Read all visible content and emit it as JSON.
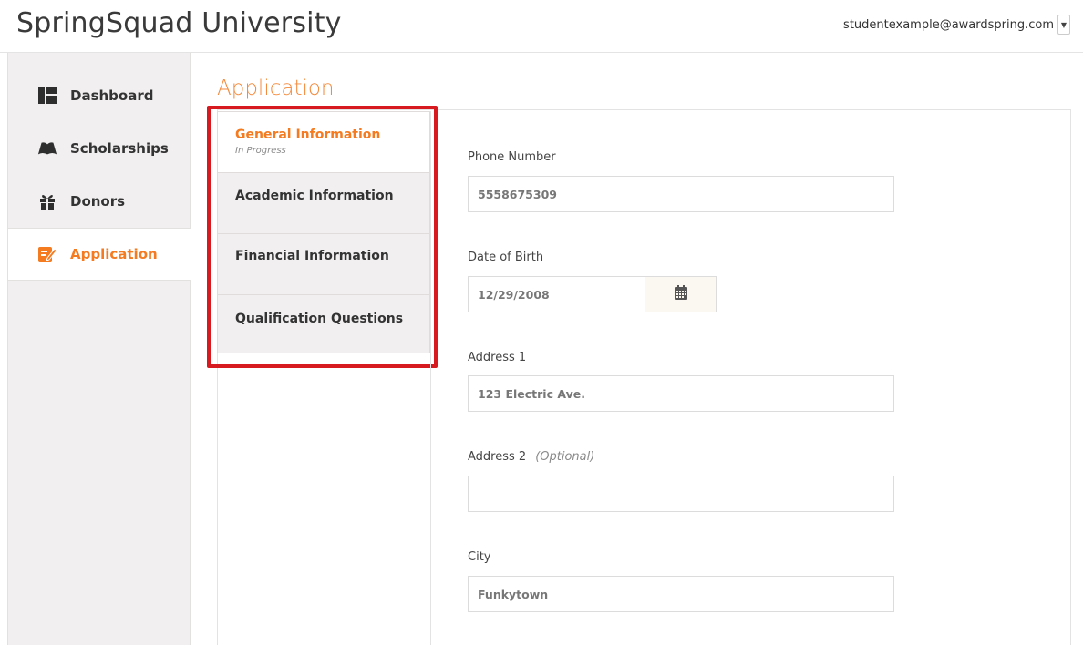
{
  "header": {
    "site_title": "SpringSquad University",
    "user_email": "studentexample@awardspring.com",
    "user_caret_icon": "caret-down-icon"
  },
  "sidebar": {
    "items": [
      {
        "label": "Dashboard",
        "icon": "dashboard-icon",
        "active": false
      },
      {
        "label": "Scholarships",
        "icon": "book-icon",
        "active": false
      },
      {
        "label": "Donors",
        "icon": "gift-icon",
        "active": false
      },
      {
        "label": "Application",
        "icon": "edit-icon",
        "active": true
      }
    ]
  },
  "main": {
    "heading": "Application",
    "steps": [
      {
        "label": "General Information",
        "status": "In Progress",
        "active": true
      },
      {
        "label": "Academic Information",
        "status": "",
        "active": false
      },
      {
        "label": "Financial Information",
        "status": "",
        "active": false
      },
      {
        "label": "Qualification Questions",
        "status": "",
        "active": false
      }
    ],
    "form": {
      "phone_label": "Phone Number",
      "phone_value": "5558675309",
      "dob_label": "Date of Birth",
      "dob_value": "12/29/2008",
      "calendar_icon": "calendar-icon",
      "address1_label": "Address 1",
      "address1_value": "123 Electric Ave.",
      "address2_label": "Address 2",
      "address2_optional": "(Optional)",
      "address2_value": "",
      "city_label": "City",
      "city_value": "Funkytown"
    }
  },
  "colors": {
    "accent": "#f47b20",
    "highlight": "#d71920",
    "sidebar_bg": "#f1efef"
  }
}
